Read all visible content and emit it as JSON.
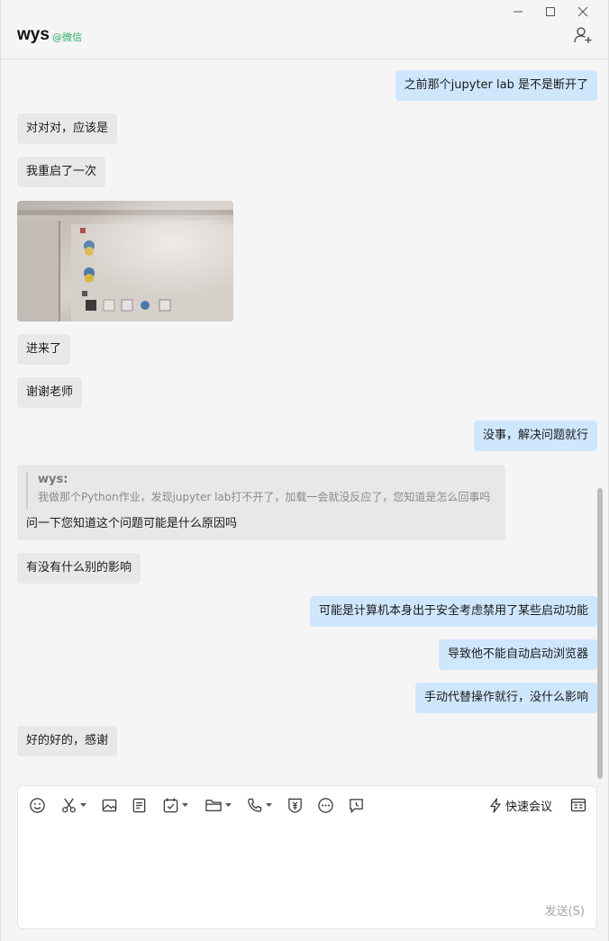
{
  "header": {
    "name": "wys",
    "tag": "@微信"
  },
  "messages": {
    "m1": "之前那个jupyter lab 是不是断开了",
    "m2": "对对对，应该是",
    "m3": "我重启了一次",
    "m4": "进来了",
    "m5": "谢谢老师",
    "m6": "没事，解决问题就行",
    "quote": {
      "author": "wys:",
      "text": "我做那个Python作业，发现jupyter lab打不开了，加载一会就没反应了，您知道是怎么回事吗",
      "reply": "问一下您知道这个问题可能是什么原因吗"
    },
    "m7": "有没有什么别的影响",
    "m8": "可能是计算机本身出于安全考虑禁用了某些启动功能",
    "m9": "导致他不能自动启动浏览器",
    "m10": "手动代替操作就行，没什么影响",
    "m11": "好的好的，感谢"
  },
  "composer": {
    "quick_meeting": "快速会议",
    "send": "发送(S)",
    "input_value": ""
  },
  "icons": {
    "toolbar": [
      "emoji-icon",
      "scissors-icon",
      "image-icon",
      "file-icon",
      "task-icon",
      "folder-icon",
      "phone-icon",
      "red-packet-icon",
      "more-icon",
      "schedule-icon"
    ],
    "accent": "#2aae67",
    "bubble_self": "#cfe7fd",
    "bubble_other": "#e8e8e8"
  }
}
